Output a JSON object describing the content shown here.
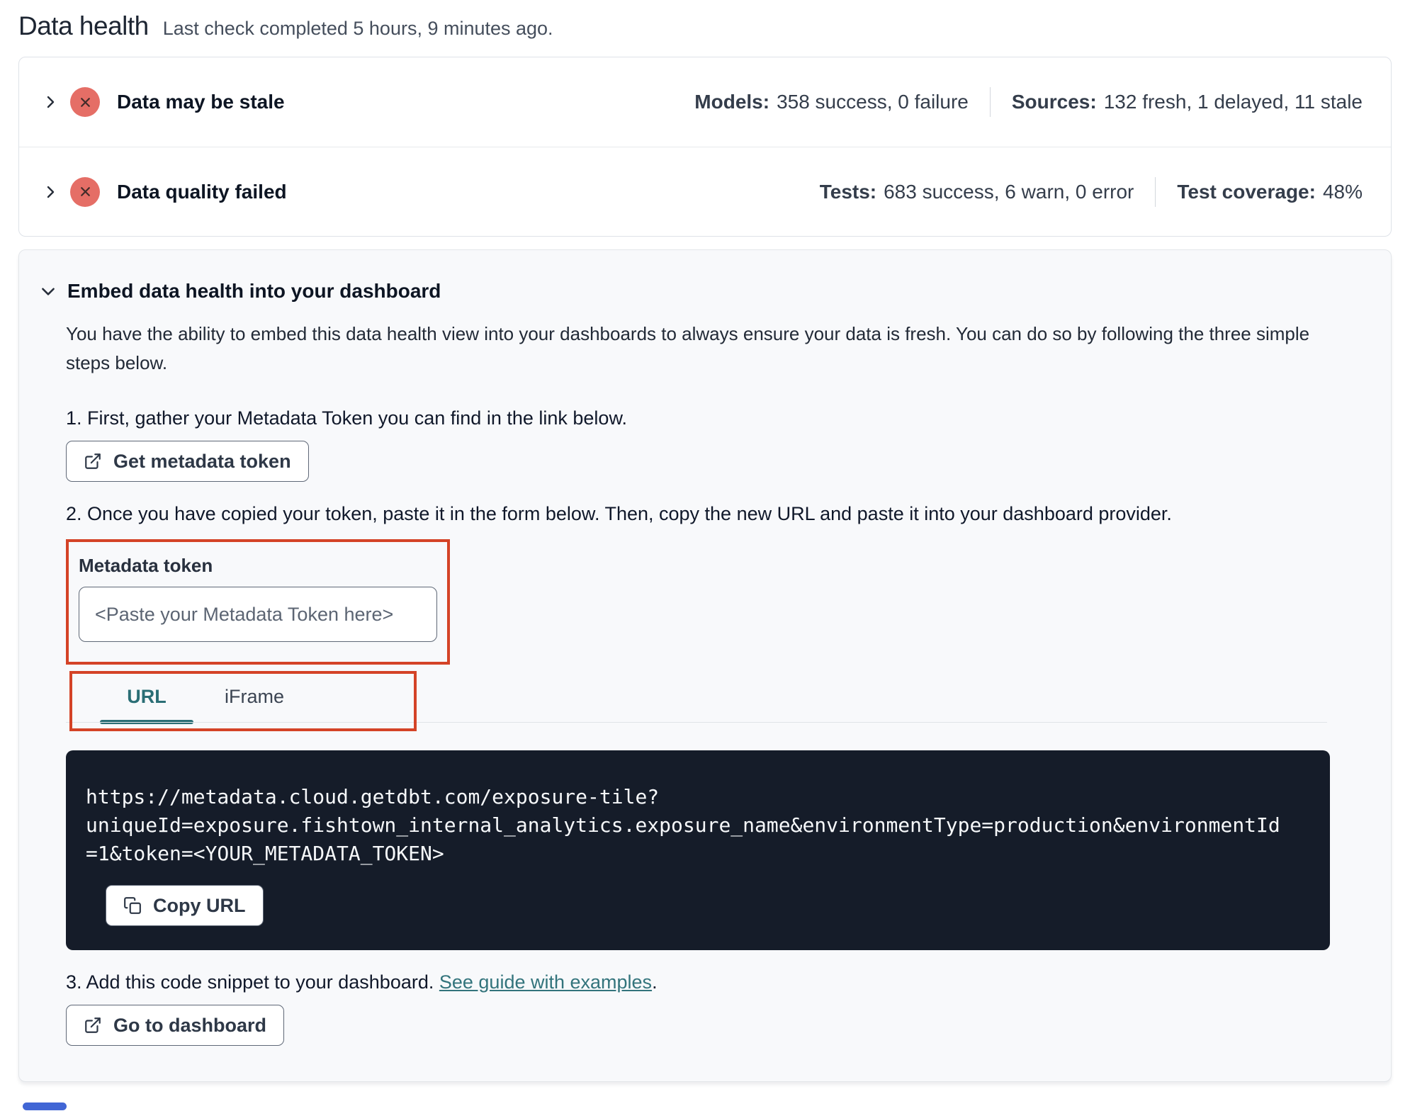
{
  "page": {
    "title": "Data health",
    "subtitle": "Last check completed 5 hours, 9 minutes ago."
  },
  "status_rows": [
    {
      "title": "Data may be stale",
      "stats": [
        {
          "label": "Models:",
          "value": "358 success, 0 failure"
        },
        {
          "label": "Sources:",
          "value": "132 fresh, 1 delayed, 11 stale"
        }
      ]
    },
    {
      "title": "Data quality failed",
      "stats": [
        {
          "label": "Tests:",
          "value": "683 success, 6 warn, 0 error"
        },
        {
          "label": "Test coverage:",
          "value": "48%"
        }
      ]
    }
  ],
  "embed": {
    "title": "Embed data health into your dashboard",
    "description": "You have the ability to embed this data health view into your dashboards to always ensure your data is fresh. You can do so by following the three simple steps below.",
    "step1": "1. First, gather your Metadata Token you can find in the link below.",
    "get_token_button": "Get metadata token",
    "step2": "2. Once you have copied your token, paste it in the form below. Then, copy the new URL and paste it into your dashboard provider.",
    "token_field": {
      "label": "Metadata token",
      "placeholder": "<Paste your Metadata Token here>"
    },
    "tabs": [
      {
        "label": "URL"
      },
      {
        "label": "iFrame"
      }
    ],
    "active_tab": "URL",
    "code_url": "https://metadata.cloud.getdbt.com/exposure-tile?uniqueId=exposure.fishtown_internal_analytics.exposure_name&environmentType=production&environmentId=1&token=<YOUR_METADATA_TOKEN>",
    "copy_button": "Copy URL",
    "step3_prefix": "3. Add this code snippet to your dashboard.",
    "step3_link": "See guide with examples",
    "step3_suffix": ".",
    "dashboard_button": "Go to dashboard"
  },
  "colors": {
    "accent_teal": "#2a6e75",
    "annotation_red": "#d44327",
    "status_error_badge": "#e56e66",
    "code_block_bg": "#151c29",
    "scrollbar_blue": "#4166d5"
  }
}
